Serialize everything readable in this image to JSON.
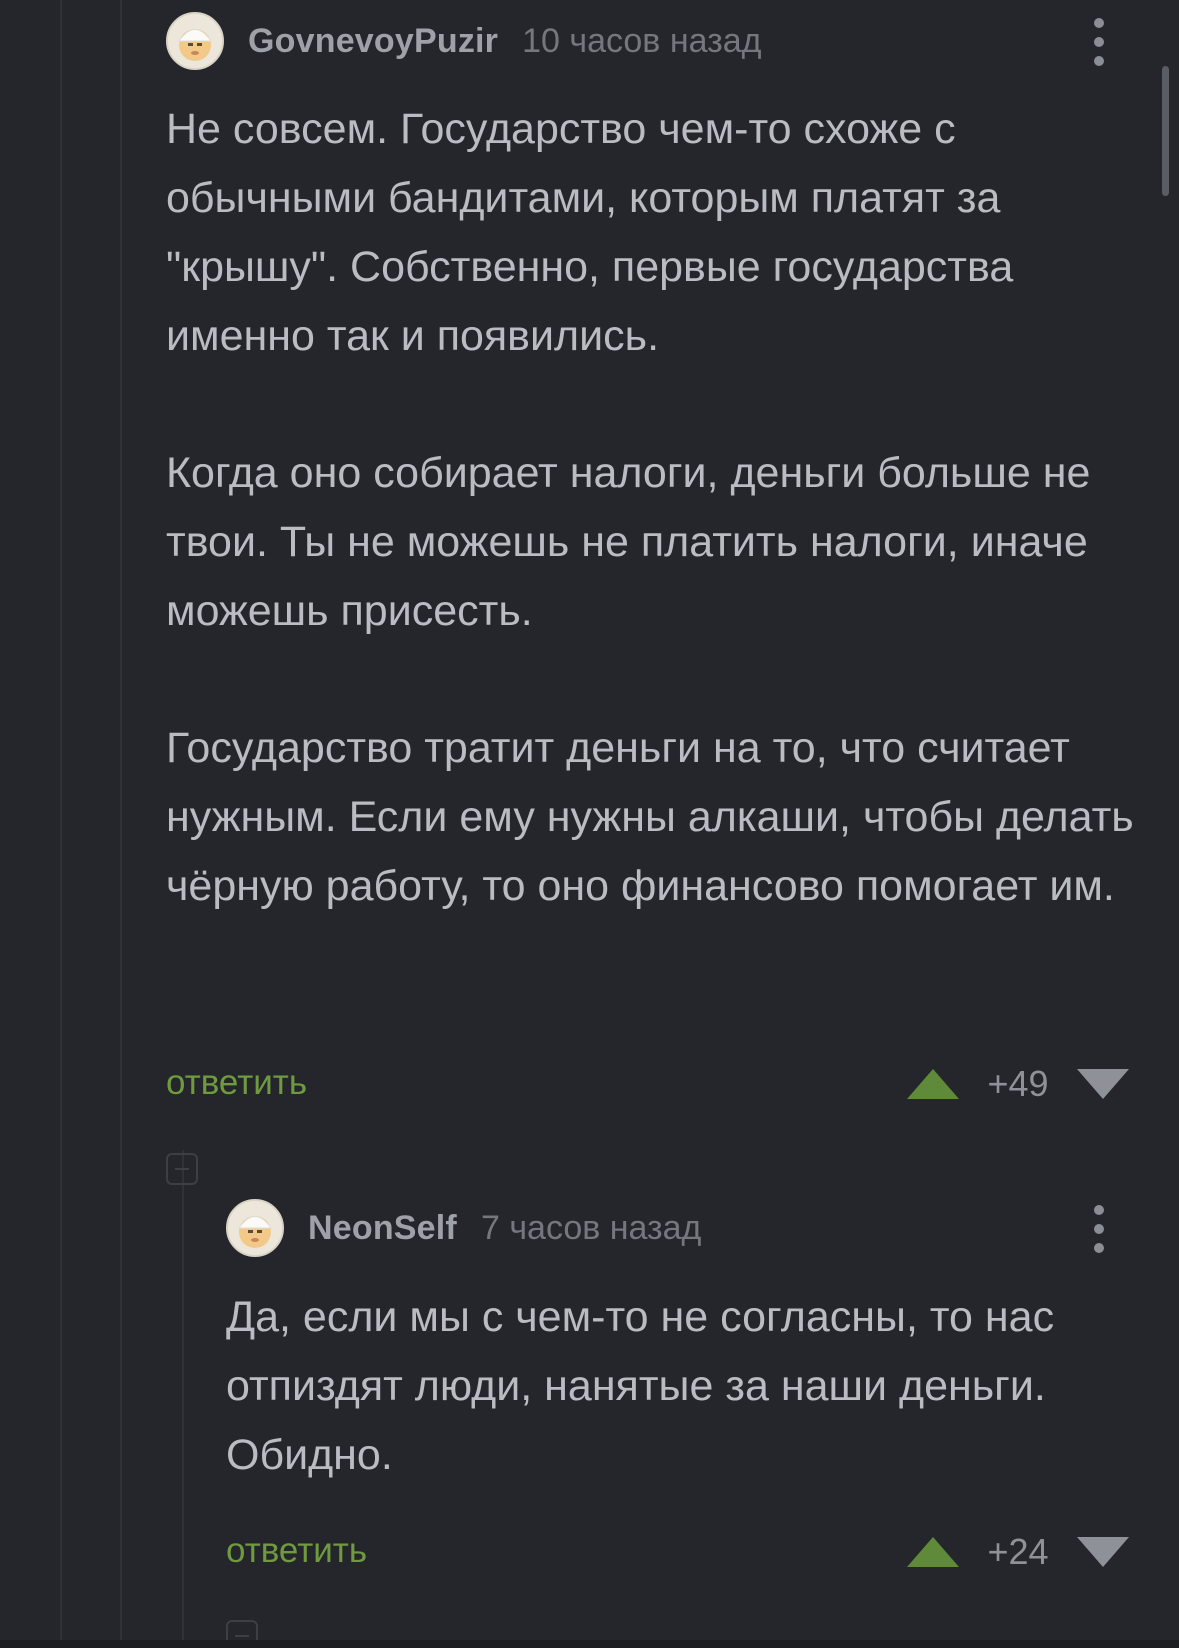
{
  "comments": [
    {
      "username": "GovnevoyPuzir",
      "time": "10 часов назад",
      "paragraphs": [
        "Не совсем. Государство чем-то схоже с обычными бандитами, которым платят за \"крышу\". Собственно, первые государства именно так и появились.",
        "Когда оно собирает налоги, деньги больше не твои. Ты не можешь не платить налоги, иначе можешь присесть.",
        "Государство тратит деньги на то, что считает нужным. Если ему нужны алкаши, чтобы делать чёрную работу, то оно финансово помогает им."
      ],
      "reply_label": "ответить",
      "score": "+49"
    },
    {
      "username": "NeonSelf",
      "time": "7 часов назад",
      "paragraphs": [
        "Да, если мы с чем-то не согласны, то нас отпиздят люди, нанятые за наши деньги. Обидно."
      ],
      "reply_label": "ответить",
      "score": "+24"
    }
  ],
  "colors": {
    "background": "#24262b",
    "text": "#b9bcc2",
    "reply_link": "#6f9a3f",
    "upvote": "#5f8a3a",
    "downvote": "#8e9198"
  },
  "icons": [
    "avatar",
    "more-vertical-icon",
    "upvote-arrow-icon",
    "downvote-arrow-icon",
    "collapse-thread-icon"
  ]
}
